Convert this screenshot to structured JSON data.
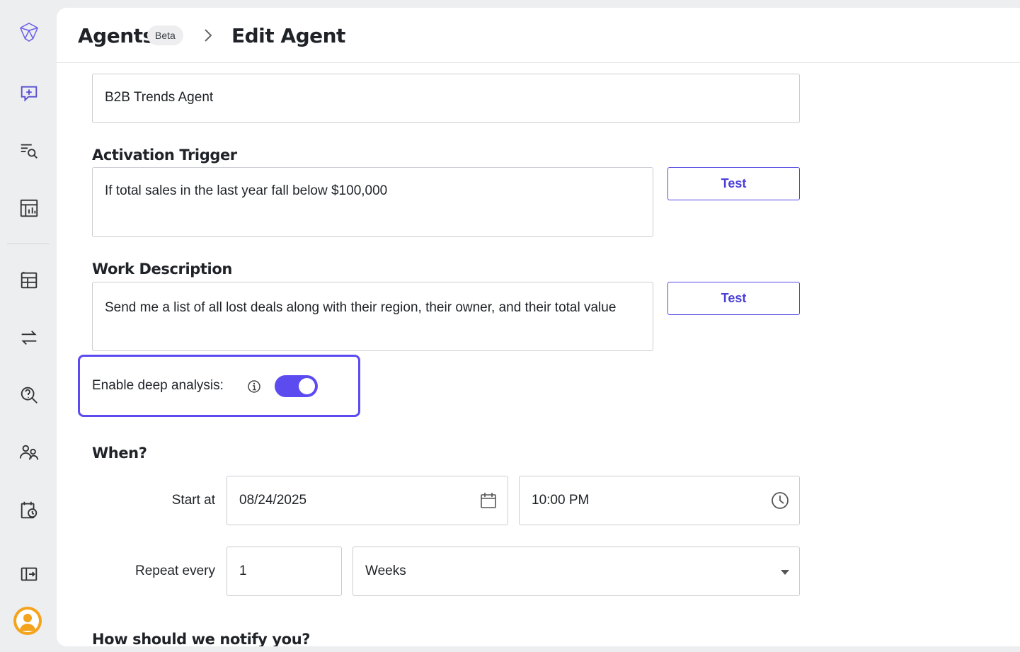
{
  "header": {
    "root": "Agents",
    "badge": "Beta",
    "page": "Edit Agent"
  },
  "form": {
    "name_value": "B2B Trends Agent",
    "trigger_label": "Activation Trigger",
    "trigger_value": "If total sales in the last year fall below $100,000",
    "work_label": "Work Description",
    "work_value": "Send me a list of all lost deals along with their region, their owner, and their total value",
    "test_label": "Test",
    "deep_label": "Enable deep analysis:",
    "deep_enabled": true,
    "when_label": "When?",
    "start_label": "Start at",
    "start_date": "08/24/2025",
    "start_time": "10:00 PM",
    "repeat_label": "Repeat every",
    "repeat_count": "1",
    "repeat_unit": "Weeks",
    "notify_label": "How should we notify you?"
  },
  "sidebar": {
    "icons": [
      "logo-icon",
      "new-chat-icon",
      "search-list-icon",
      "report-icon",
      "table-icon",
      "transfer-icon",
      "help-search-icon",
      "users-icon",
      "calendar-clock-icon",
      "expand-sidebar-icon"
    ]
  },
  "colors": {
    "accent": "#5c4cf0",
    "sidebar_icon": "#3a3d66",
    "avatar": "#f4a31d"
  }
}
